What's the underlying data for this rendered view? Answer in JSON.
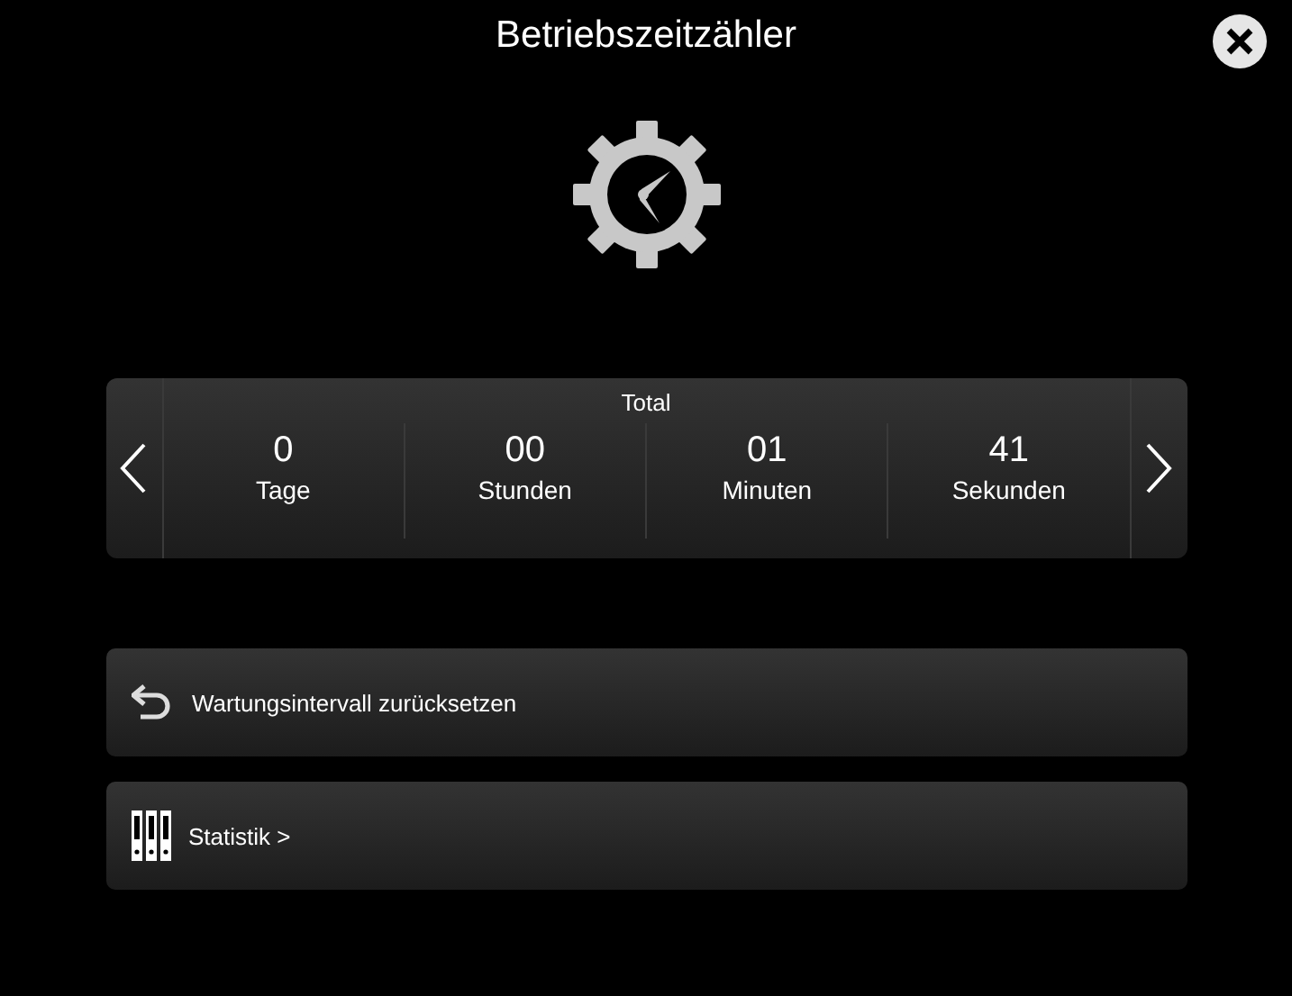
{
  "window": {
    "title": "Betriebszeitzähler"
  },
  "counter": {
    "title": "Total",
    "units": [
      {
        "value": "0",
        "label": "Tage"
      },
      {
        "value": "00",
        "label": "Stunden"
      },
      {
        "value": "01",
        "label": "Minuten"
      },
      {
        "value": "41",
        "label": "Sekunden"
      }
    ]
  },
  "actions": [
    {
      "kind": "reset",
      "label": "Wartungsintervall zurücksetzen"
    },
    {
      "kind": "stats",
      "label": "Statistik >"
    }
  ]
}
